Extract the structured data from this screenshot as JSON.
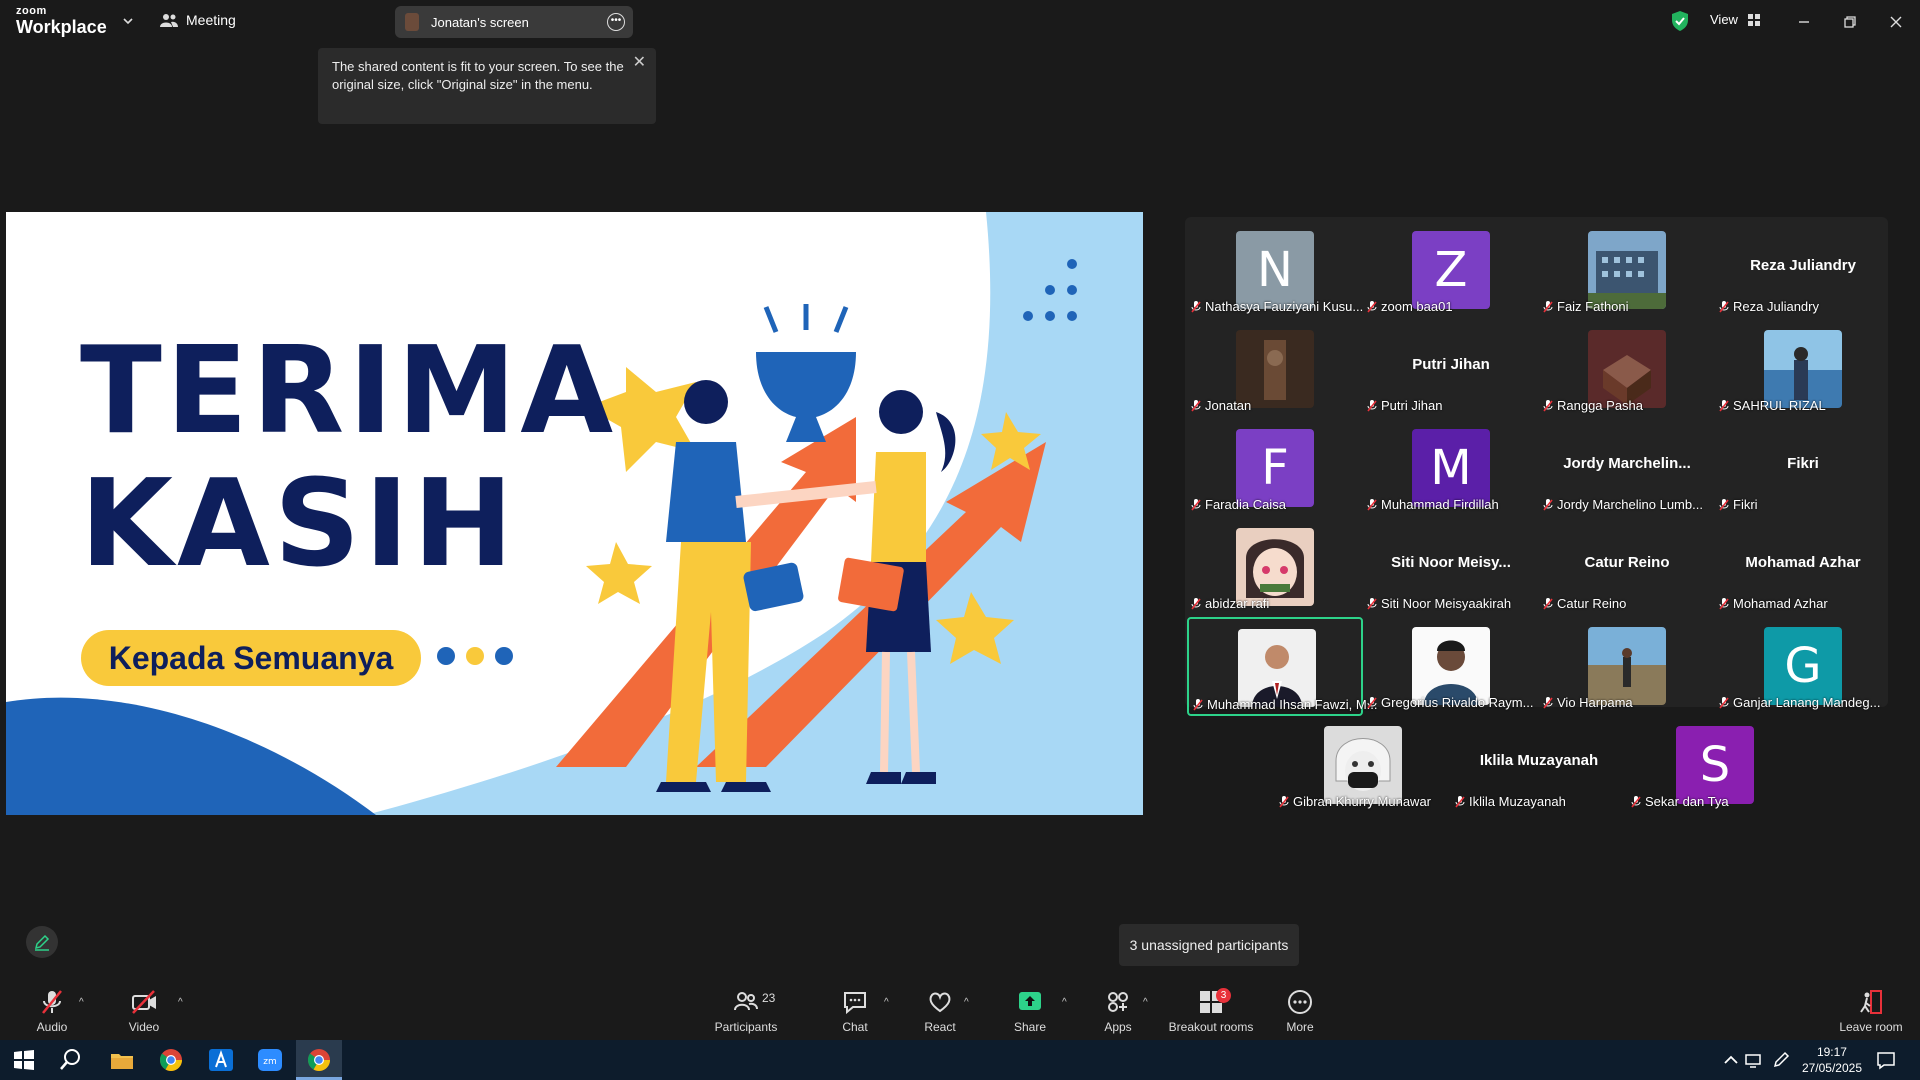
{
  "app": {
    "logo_top": "zoom",
    "logo_bottom": "Workplace",
    "meeting_label": "Meeting",
    "screen_share_label": "Jonatan's screen",
    "view_label": "View"
  },
  "tooltip": {
    "text": "The shared content is fit to your screen. To see the original size, click \"Original size\" in the menu."
  },
  "slide": {
    "line1": "TERIMA",
    "line2": "KASIH",
    "pill": "Kepada Semuanya"
  },
  "participants": [
    {
      "avatar": "N",
      "color": "#8a9aa5",
      "name": "Nathasya Fauziyani Kusu..."
    },
    {
      "avatar": "Z",
      "color": "#7b3fc4",
      "name": "zoom baa01"
    },
    {
      "photo": "building",
      "name": "Faiz Fathoni"
    },
    {
      "big": "Reza Juliandry",
      "name": "Reza Juliandry"
    },
    {
      "photo": "dark",
      "name": "Jonatan"
    },
    {
      "big": "Putri Jihan",
      "name": "Putri Jihan"
    },
    {
      "photo": "box",
      "name": "Rangga Pasha"
    },
    {
      "photo": "sea",
      "name": "SAHRUL RIZAL"
    },
    {
      "avatar": "F",
      "color": "#7b3fc4",
      "name": "Faradia Caisa"
    },
    {
      "avatar": "M",
      "color": "#5b1fa8",
      "name": "Muhammad Firdillah"
    },
    {
      "big": "Jordy  Marchelin...",
      "name": "Jordy Marchelino Lumb..."
    },
    {
      "big": "Fikri",
      "name": "Fikri"
    },
    {
      "photo": "anime",
      "name": "abidzar rafi"
    },
    {
      "big": "Siti  Noor  Meisy...",
      "name": "Siti Noor Meisyaakirah"
    },
    {
      "big": "Catur Reino",
      "name": "Catur Reino"
    },
    {
      "big": "Mohamad Azhar",
      "name": "Mohamad Azhar"
    },
    {
      "photo": "suit",
      "name": "Muhammad Ihsan Fawzi, M...",
      "active": true
    },
    {
      "photo": "man",
      "name": "Gregorius Rivaldo Raym..."
    },
    {
      "photo": "field",
      "name": "Vio Harpama"
    },
    {
      "avatar": "G",
      "color": "#0e9aa7",
      "name": "Ganjar Lanang Mandeg..."
    },
    {
      "photo": "mask",
      "name": "Gibran Khurry Munawar"
    },
    {
      "big": "Iklila Muzayanah",
      "name": "Iklila Muzayanah"
    },
    {
      "avatar": "S",
      "color": "#8a1fb0",
      "name": "Sekar dan Tya"
    }
  ],
  "unassigned": "3 unassigned participants",
  "toolbar": {
    "audio": "Audio",
    "video": "Video",
    "participants": "Participants",
    "participants_count": "23",
    "chat": "Chat",
    "react": "React",
    "share": "Share",
    "apps": "Apps",
    "breakout": "Breakout rooms",
    "breakout_badge": "3",
    "more": "More",
    "leave": "Leave room"
  },
  "taskbar": {
    "time": "19:17",
    "date": "27/05/2025"
  }
}
